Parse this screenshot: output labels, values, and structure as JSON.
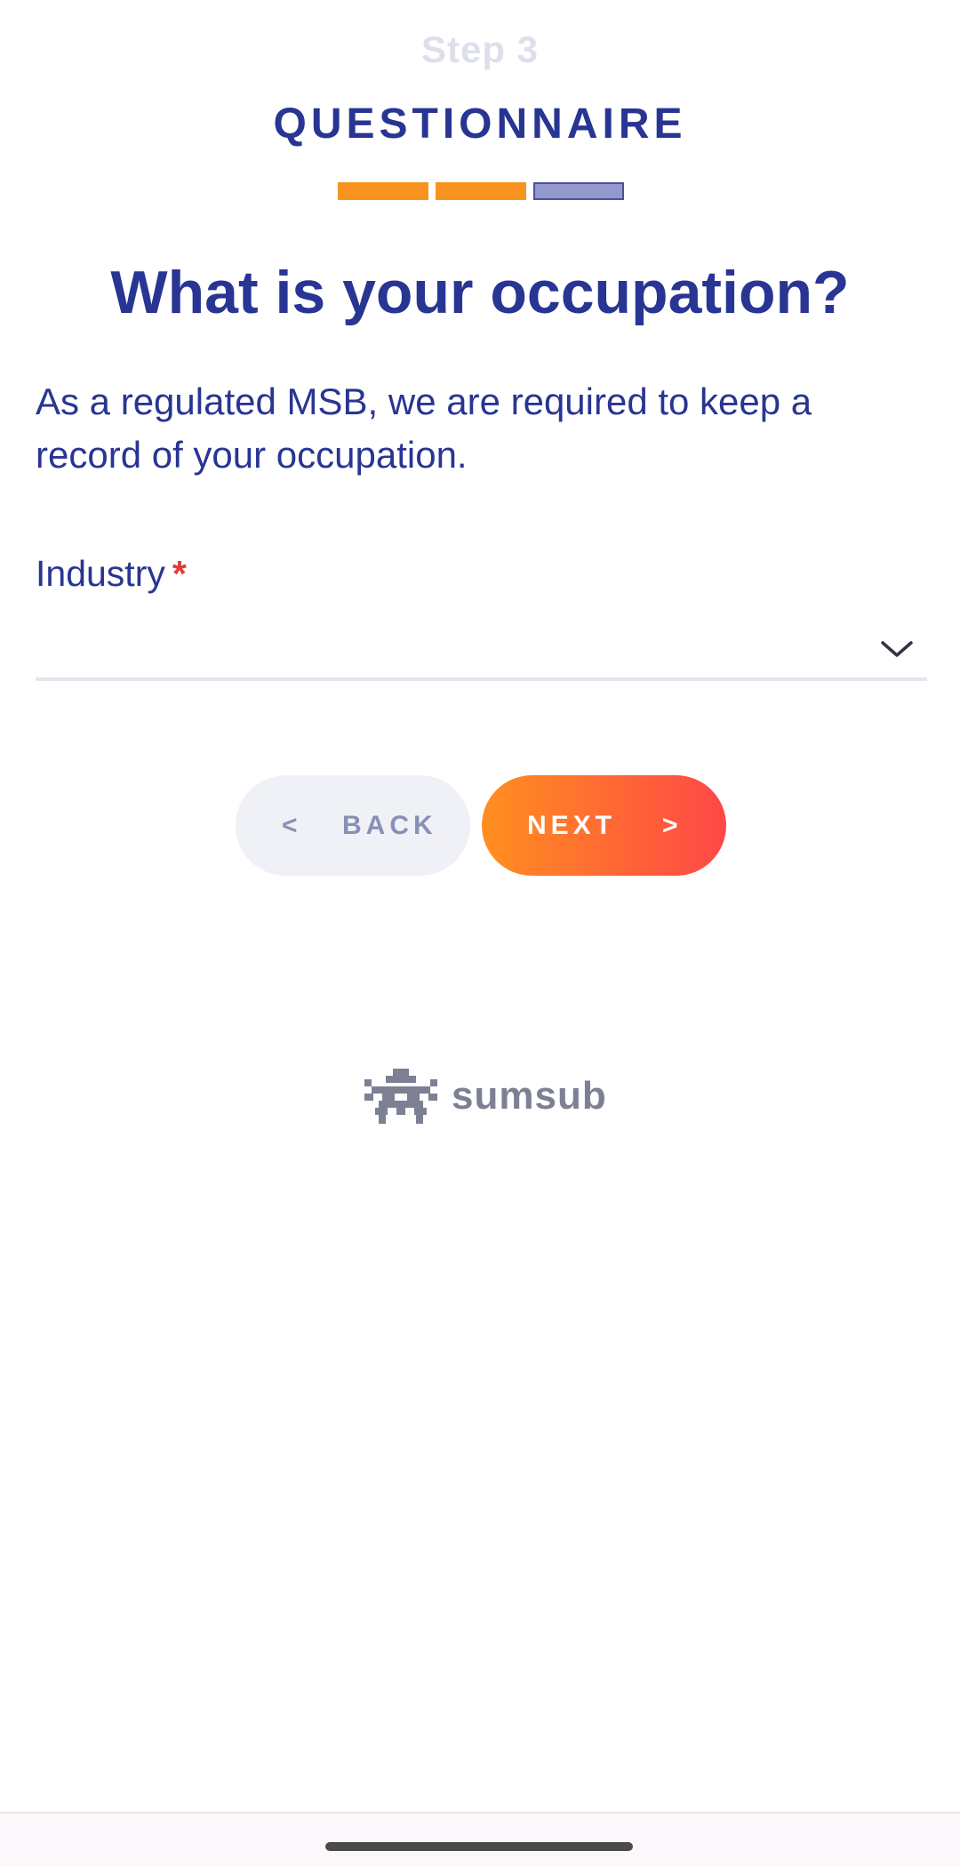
{
  "header": {
    "step": "Step 3",
    "title": "QUESTIONNAIRE",
    "progress": {
      "completed_segments": 2,
      "total_segments": 3
    }
  },
  "question": {
    "title": "What is your occupation?",
    "description": "As a regulated MSB, we are required to keep a record of your occupation."
  },
  "form": {
    "industry": {
      "label": "Industry",
      "required_mark": "*",
      "value": "",
      "icon": "chevron-down-icon"
    }
  },
  "buttons": {
    "back_arrow": "<",
    "back_label": "BACK",
    "next_label": "NEXT",
    "next_arrow": ">"
  },
  "brand": {
    "name": "sumsub",
    "logo": "sumsub-logo"
  },
  "colors": {
    "primary": "#283593",
    "accent": "#f7931e",
    "next_gradient_start": "#ff8f1f",
    "next_gradient_end": "#ff4747",
    "required": "#e53935",
    "muted": "#8890b5"
  }
}
